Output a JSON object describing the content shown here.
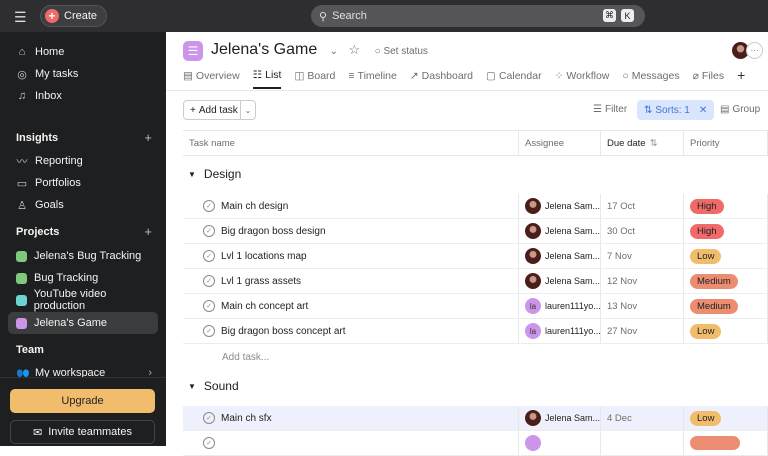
{
  "topbar": {
    "create_label": "Create",
    "search_placeholder": "Search",
    "shortcut_cmd": "⌘",
    "shortcut_key": "K"
  },
  "sidebar": {
    "nav": [
      {
        "label": "Home",
        "icon": "home-icon"
      },
      {
        "label": "My tasks",
        "icon": "check-circle-icon"
      },
      {
        "label": "Inbox",
        "icon": "bell-icon"
      }
    ],
    "insights_heading": "Insights",
    "insights": [
      {
        "label": "Reporting"
      },
      {
        "label": "Portfolios"
      },
      {
        "label": "Goals"
      }
    ],
    "projects_heading": "Projects",
    "projects": [
      {
        "label": "Jelena's Bug Tracking",
        "color": "#7fc97f"
      },
      {
        "label": "Bug Tracking",
        "color": "#7fc97f"
      },
      {
        "label": "YouTube video production",
        "color": "#6fd3d3"
      },
      {
        "label": "Jelena's Game",
        "color": "#cd95ea"
      }
    ],
    "team_heading": "Team",
    "team_item": "My workspace",
    "upgrade_label": "Upgrade",
    "invite_label": "Invite teammates"
  },
  "project": {
    "title": "Jelena's Game",
    "set_status": "Set status",
    "tabs": [
      "Overview",
      "List",
      "Board",
      "Timeline",
      "Dashboard",
      "Calendar",
      "Workflow",
      "Messages",
      "Files"
    ],
    "add_task": "Add task",
    "filter": "Filter",
    "sorts": "Sorts: 1",
    "group": "Group"
  },
  "columns": {
    "task": "Task name",
    "assignee": "Assignee",
    "due": "Due date",
    "priority": "Priority"
  },
  "sections": [
    {
      "name": "Design",
      "tasks": [
        {
          "name": "Main ch design",
          "assignee": "Jelena Sam...",
          "avatar": "img",
          "due": "17 Oct",
          "priority": "High"
        },
        {
          "name": "Big dragon boss design",
          "assignee": "Jelena Sam...",
          "avatar": "img",
          "due": "30 Oct",
          "priority": "High"
        },
        {
          "name": "Lvl 1 locations map",
          "assignee": "Jelena Sam...",
          "avatar": "img",
          "due": "7 Nov",
          "priority": "Low"
        },
        {
          "name": "Lvl 1 grass assets",
          "assignee": "Jelena Sam...",
          "avatar": "img",
          "due": "12 Nov",
          "priority": "Medium"
        },
        {
          "name": "Main ch concept art",
          "assignee": "lauren111yo...",
          "avatar": "la",
          "due": "13 Nov",
          "priority": "Medium"
        },
        {
          "name": "Big dragon boss concept art",
          "assignee": "lauren111yo...",
          "avatar": "la",
          "due": "27 Nov",
          "priority": "Low"
        }
      ]
    },
    {
      "name": "Sound",
      "tasks": [
        {
          "name": "Main ch sfx",
          "assignee": "Jelena Sam...",
          "avatar": "img",
          "due": "4 Dec",
          "priority": "Low"
        }
      ]
    }
  ],
  "add_task_row": "Add task...",
  "priority_colors": {
    "High": "#f06a6a",
    "Medium": "#ec8d71",
    "Low": "#f1bd6c"
  }
}
